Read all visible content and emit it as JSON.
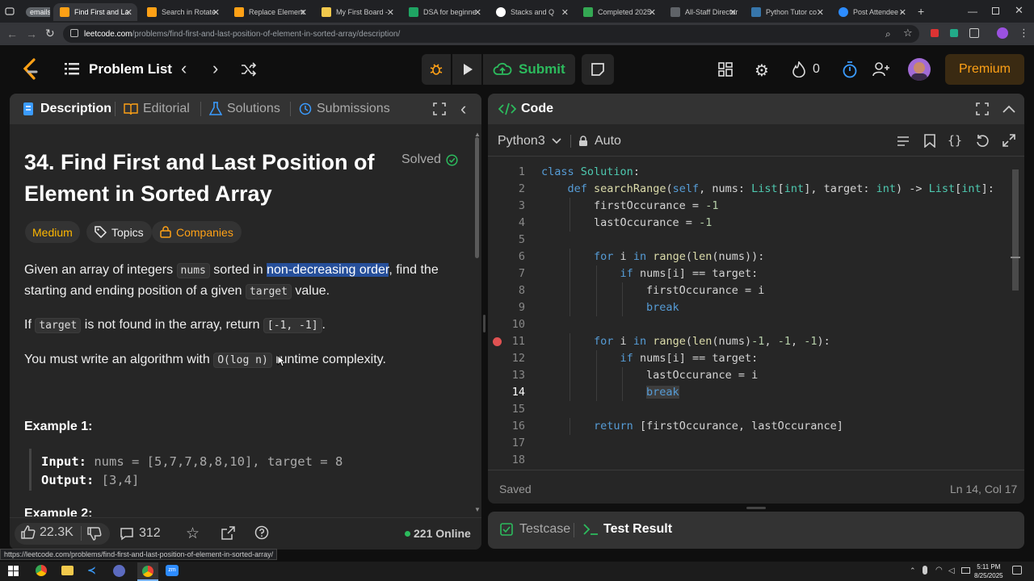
{
  "browser": {
    "tabs": [
      {
        "label": "emails",
        "active": false
      },
      {
        "label": "Find First and La",
        "active": true
      },
      {
        "label": "Search in Rotate",
        "active": false
      },
      {
        "label": "Replace Element",
        "active": false
      },
      {
        "label": "My First Board -",
        "active": false
      },
      {
        "label": "DSA for beginne",
        "active": false
      },
      {
        "label": "Stacks and Q",
        "active": false
      },
      {
        "label": "Completed 2025",
        "active": false
      },
      {
        "label": "All-Staff Director",
        "active": false
      },
      {
        "label": "Python Tutor co",
        "active": false
      },
      {
        "label": "Post Attendee -",
        "active": false
      }
    ],
    "url_host": "leetcode.com",
    "url_path": "/problems/find-first-and-last-position-of-element-in-sorted-array/description/",
    "status_url": "https://leetcode.com/problems/find-first-and-last-position-of-element-in-sorted-array/"
  },
  "nav": {
    "problem_list": "Problem List",
    "submit": "Submit",
    "streak_count": "0",
    "premium": "Premium"
  },
  "left_tabs": {
    "description": "Description",
    "editorial": "Editorial",
    "solutions": "Solutions",
    "submissions": "Submissions"
  },
  "problem": {
    "title_line1": "34. Find First and Last Position of",
    "title_line2": "Element in Sorted Array",
    "solved": "Solved",
    "difficulty": "Medium",
    "topics": "Topics",
    "companies": "Companies",
    "p1_a": "Given an array of integers ",
    "p1_code": "nums",
    "p1_b": " sorted in ",
    "p1_highlight": "non-decreasing order",
    "p1_c": ", find the",
    "p1_d": "starting and ending position of a given ",
    "p1_code2": "target",
    "p1_e": " value.",
    "p2_a": "If ",
    "p2_code": "target",
    "p2_b": " is not found in the array, return ",
    "p2_code2": "[-1, -1]",
    "p2_c": ".",
    "p3_a": "You must write an algorithm with ",
    "p3_code": "O(log n)",
    "p3_b": " runtime complexity.",
    "example1_title": "Example 1:",
    "example1_input_label": "Input:",
    "example1_input": " nums = [5,7,7,8,8,10], target = 8",
    "example1_output_label": "Output:",
    "example1_output": " [3,4]",
    "example2_title": "Example 2:"
  },
  "footer_left": {
    "likes": "22.3K",
    "comments": "312",
    "online": "221 Online"
  },
  "code": {
    "header": "Code",
    "language": "Python3",
    "auto": "Auto",
    "saved": "Saved",
    "cursor": "Ln 14, Col 17",
    "active_line": 14,
    "breakpoint_line": 11,
    "lines": [
      "class Solution:",
      "    def searchRange(self, nums: List[int], target: int) -> List[int]:",
      "        firstOccurance = -1",
      "        lastOccurance = -1",
      "",
      "        for i in range(len(nums)):",
      "            if nums[i] == target:",
      "                firstOccurance = i",
      "                break",
      "",
      "        for i in range(len(nums)-1, -1, -1):",
      "            if nums[i] == target:",
      "                lastOccurance = i",
      "                break",
      "",
      "        return [firstOccurance, lastOccurance]",
      "",
      ""
    ]
  },
  "bottom_panel": {
    "testcase": "Testcase",
    "test_result": "Test Result"
  },
  "taskbar": {
    "time": "5:11 PM",
    "date": "8/25/2025"
  },
  "colors": {
    "accent_green": "#2cbb5d",
    "premium_orange": "#ffa116",
    "medium": "#ffb800",
    "highlight": "#264f9a"
  }
}
